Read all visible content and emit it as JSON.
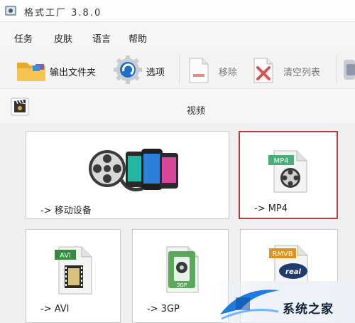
{
  "window": {
    "title": "格式工厂 3.8.0"
  },
  "menu": {
    "items": [
      "任务",
      "皮肤",
      "语言",
      "帮助"
    ]
  },
  "toolbar": {
    "output_folder_label": "输出文件夹",
    "options_label": "选项",
    "remove_label": "移除",
    "clear_list_label": "清空列表"
  },
  "category": {
    "title": "视频"
  },
  "tiles": {
    "mobile": {
      "label": "-> 移动设备"
    },
    "mp4": {
      "label": "-> MP4",
      "badge": "MP4"
    },
    "avi": {
      "label": "-> AVI",
      "badge": "AVI"
    },
    "3gp": {
      "label": "-> 3GP",
      "badge": "3GP"
    },
    "rmvb": {
      "badge": "RMVB",
      "sub": "real"
    }
  },
  "watermark": {
    "text": "系统之家"
  },
  "colors": {
    "selected_border": "#c0393b",
    "accent_blue": "#1b6fc9"
  }
}
